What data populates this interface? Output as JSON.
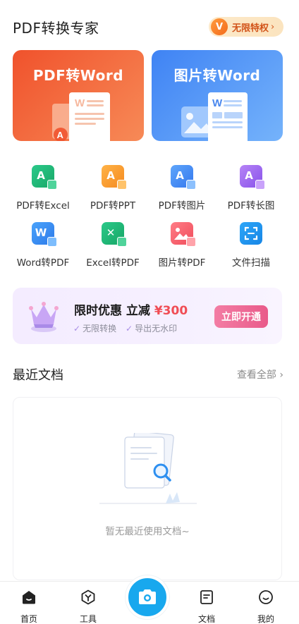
{
  "header": {
    "title": "PDF转换专家",
    "vip": {
      "badge": "V",
      "label": "无限特权",
      "chevron": "›"
    }
  },
  "feature_cards": [
    {
      "title": "PDF转Word",
      "color": "#f0522c"
    },
    {
      "title": "图片转Word",
      "color": "#3f83f4"
    }
  ],
  "tools": [
    {
      "label": "PDF转Excel",
      "icon": "pdf-to-excel-icon"
    },
    {
      "label": "PDF转PPT",
      "icon": "pdf-to-ppt-icon"
    },
    {
      "label": "PDF转图片",
      "icon": "pdf-to-image-icon"
    },
    {
      "label": "PDF转长图",
      "icon": "pdf-to-long-image-icon"
    },
    {
      "label": "Word转PDF",
      "icon": "word-to-pdf-icon"
    },
    {
      "label": "Excel转PDF",
      "icon": "excel-to-pdf-icon"
    },
    {
      "label": "图片转PDF",
      "icon": "image-to-pdf-icon"
    },
    {
      "label": "文件扫描",
      "icon": "scan-icon"
    }
  ],
  "promo": {
    "title": "限时优惠 立减",
    "amount": "¥300",
    "features": [
      "无限转换",
      "导出无水印"
    ],
    "check": "✓",
    "button": "立即开通"
  },
  "recent": {
    "title": "最近文档",
    "view_all": "查看全部",
    "chevron": "›",
    "empty_text": "暂无最近使用文档~"
  },
  "bottom_nav": [
    {
      "label": "首页",
      "icon": "home-icon",
      "active": true
    },
    {
      "label": "工具",
      "icon": "tools-icon",
      "active": false
    },
    {
      "label": "文档",
      "icon": "document-icon",
      "active": false
    },
    {
      "label": "我的",
      "icon": "profile-icon",
      "active": false
    }
  ],
  "colors": {
    "accent_blue": "#18a8ee",
    "pdf_orange": "#f0522c",
    "promo_pink": "#e95a8a",
    "price_red": "#f04d55"
  }
}
